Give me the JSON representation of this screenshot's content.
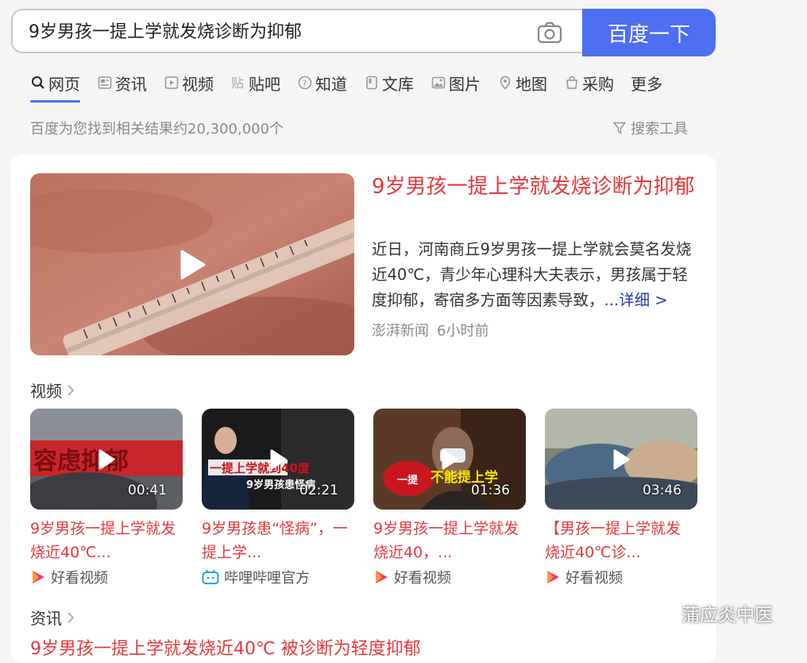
{
  "search": {
    "query": "9岁男孩一提上学就发烧诊断为抑郁",
    "button_label": "百度一下"
  },
  "tabs": [
    {
      "label": "网页",
      "icon": "search-icon",
      "active": true
    },
    {
      "label": "资讯",
      "icon": "news-icon"
    },
    {
      "label": "视频",
      "icon": "video-icon"
    },
    {
      "label": "贴吧",
      "icon": "tieba-icon"
    },
    {
      "label": "知道",
      "icon": "question-icon"
    },
    {
      "label": "文库",
      "icon": "document-icon"
    },
    {
      "label": "图片",
      "icon": "image-icon"
    },
    {
      "label": "地图",
      "icon": "map-icon"
    },
    {
      "label": "采购",
      "icon": "shopping-icon"
    },
    {
      "label": "更多"
    }
  ],
  "result_count": "百度为您找到相关结果约20,300,000个",
  "search_tools": "搜索工具",
  "main_result": {
    "title": "9岁男孩一提上学就发烧诊断为抑郁",
    "description": "近日，河南商丘9岁男孩一提上学就会莫名发烧近40℃，青少年心理科大夫表示，男孩属于轻度抑郁，寄宿多方面等因素导致，",
    "more_label": "...详细 >",
    "source": "澎湃新闻",
    "time": "6小时前"
  },
  "video_section": {
    "title": "视频",
    "videos": [
      {
        "duration": "00:41",
        "title_line1": "9岁男孩一提上学就发",
        "title_line2": "烧近40℃...",
        "source": "好看视频",
        "source_icon": "haokan-icon"
      },
      {
        "duration": "02:21",
        "title_line1": "9岁男孩患“怪病”，一",
        "title_line2": "提上学...",
        "source": "哔哩哔哩官方",
        "source_icon": "bilibili-icon"
      },
      {
        "duration": "01:36",
        "title_line1": "9岁男孩一提上学就发",
        "title_line2": "烧近40，...",
        "source": "好看视频",
        "source_icon": "haokan-icon"
      },
      {
        "duration": "03:46",
        "title_line1": "【男孩一提上学就发",
        "title_line2": "烧近40℃诊...",
        "source": "好看视频",
        "source_icon": "haokan-icon"
      }
    ]
  },
  "news_section": {
    "title": "资讯",
    "first_item": "9岁男孩一提上学就发烧近40℃ 被诊断为轻度抑郁"
  },
  "watermark": "蒲应炎中医",
  "colors": {
    "accent": "#4e6ef2",
    "title_red": "#e4383c",
    "link_blue": "#2440b3"
  }
}
